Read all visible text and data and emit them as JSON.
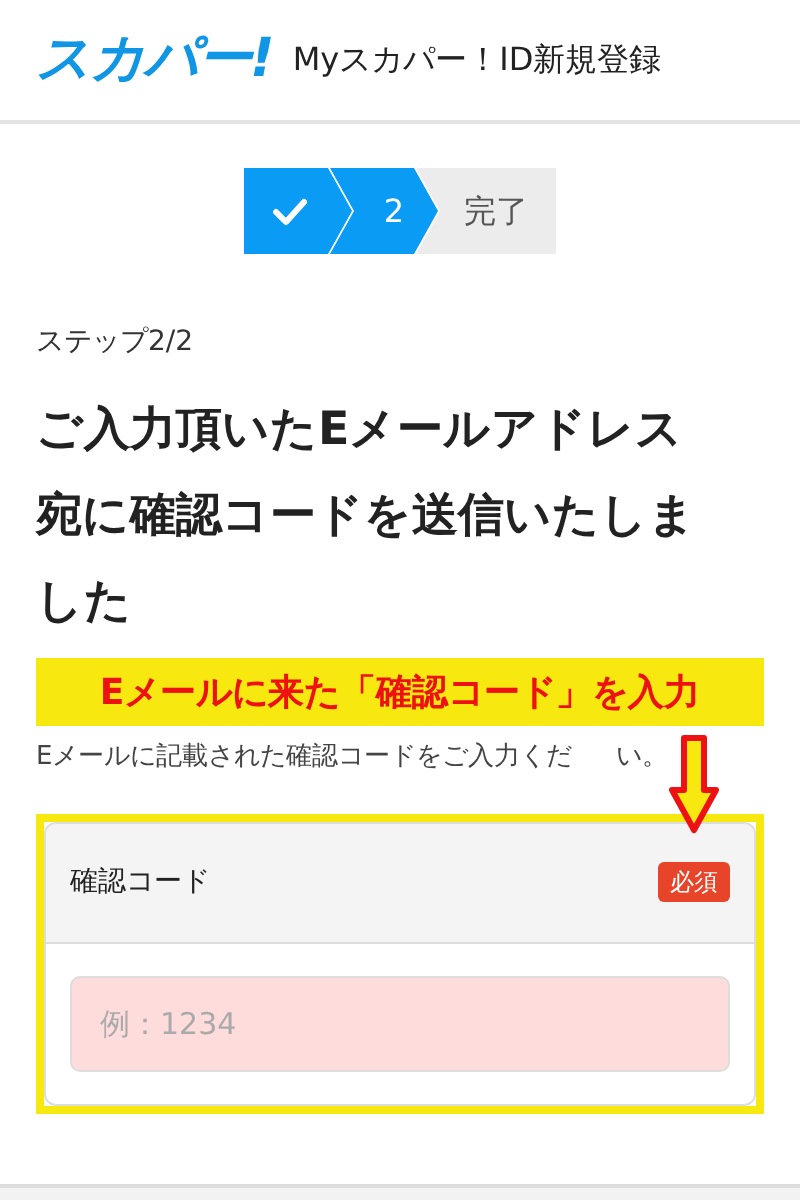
{
  "header": {
    "logo": "スカパー!",
    "title": "Myスカパー！ID新規登録"
  },
  "steps": [
    {
      "kind": "done"
    },
    {
      "kind": "current",
      "label": "2"
    },
    {
      "kind": "pending",
      "label": "完了"
    }
  ],
  "step_caption": "ステップ2/2",
  "heading": "ご入力頂いたEメールアドレス宛に確認コードを送信いたしました",
  "annotation": {
    "callout": "Eメールに来た「確認コード」を入力"
  },
  "description": [
    "Eメールに記載された確認コードをご入力くだ",
    "い。"
  ],
  "form": {
    "label": "確認コード",
    "required_badge": "必須",
    "field": {
      "placeholder": "例：1234"
    }
  }
}
